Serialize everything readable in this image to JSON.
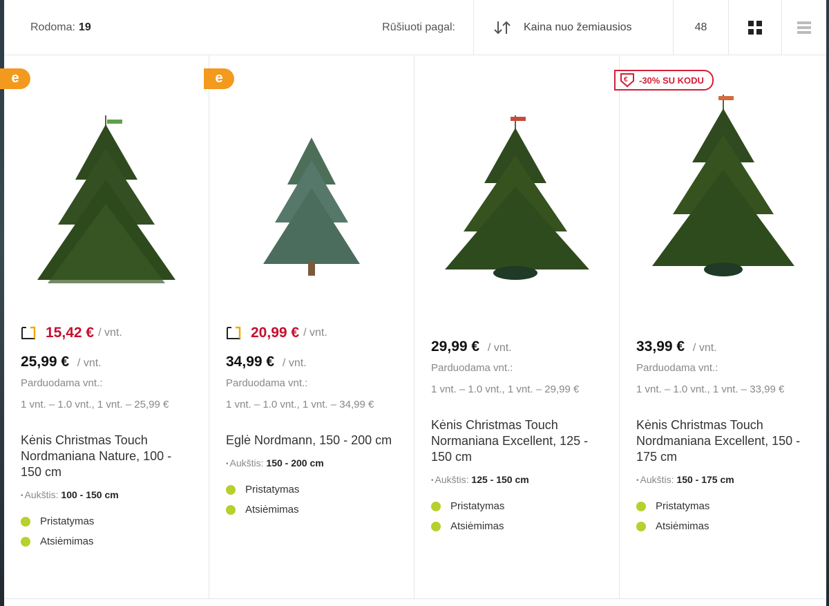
{
  "toolbar": {
    "showing_label": "Rodoma:",
    "showing_count": "19",
    "sort_label": "Rūšiuoti pagal:",
    "sort_value": "Kaina nuo žemiausios",
    "per_page": "48"
  },
  "colors": {
    "promo_red": "#c4102f",
    "e_badge": "#f39a1e",
    "availability": "#b9cf2c"
  },
  "products": [
    {
      "badge": "e",
      "promo_price": "15,42 €",
      "price": "25,99 €",
      "unit": "/ vnt.",
      "sold_label": "Parduodama vnt.:",
      "sold_value": "1 vnt. – 1.0 vnt., 1 vnt. – 25,99 €",
      "title": "Kėnis Christmas Touch Nordmaniana Nature, 100 - 150 cm",
      "height_label": "Aukštis:",
      "height_value": "100 - 150 cm",
      "options": [
        "Pristatymas",
        "Atsiėmimas"
      ]
    },
    {
      "badge": "e",
      "promo_price": "20,99 €",
      "price": "34,99 €",
      "unit": "/ vnt.",
      "sold_label": "Parduodama vnt.:",
      "sold_value": "1 vnt. – 1.0 vnt., 1 vnt. – 34,99 €",
      "title": "Eglė Nordmann, 150 - 200 cm",
      "height_label": "Aukštis:",
      "height_value": "150 - 200 cm",
      "options": [
        "Pristatymas",
        "Atsiėmimas"
      ]
    },
    {
      "price": "29,99 €",
      "unit": "/ vnt.",
      "sold_label": "Parduodama vnt.:",
      "sold_value": "1 vnt. – 1.0 vnt., 1 vnt. – 29,99 €",
      "title": "Kėnis Christmas Touch Normaniana Excellent, 125 - 150 cm",
      "height_label": "Aukštis:",
      "height_value": "125 - 150 cm",
      "options": [
        "Pristatymas",
        "Atsiėmimas"
      ]
    },
    {
      "promo_badge": "-30% SU KODU",
      "price": "33,99 €",
      "unit": "/ vnt.",
      "sold_label": "Parduodama vnt.:",
      "sold_value": "1 vnt. – 1.0 vnt., 1 vnt. – 33,99 €",
      "title": "Kėnis Christmas Touch Nordmaniana Excellent, 150 - 175 cm",
      "height_label": "Aukštis:",
      "height_value": "150 - 175 cm",
      "options": [
        "Pristatymas",
        "Atsiėmimas"
      ]
    }
  ]
}
